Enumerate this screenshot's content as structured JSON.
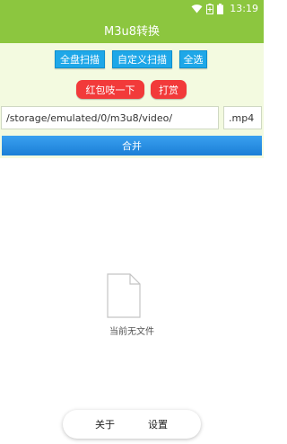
{
  "status_bar": {
    "time": "13:19"
  },
  "app_bar": {
    "title": "M3u8转换"
  },
  "toolbar": {
    "scan_all_label": "全盘扫描",
    "custom_scan_label": "自定义扫描",
    "select_all_label": "全选",
    "red_packet_label": "红包吱一下",
    "reward_label": "打赏"
  },
  "path_field": {
    "value": "/storage/emulated/0/m3u8/video/"
  },
  "ext_field": {
    "value": ".mp4"
  },
  "merge_button": {
    "label": "合并"
  },
  "empty_state": {
    "message": "当前无文件"
  },
  "bottom_nav": {
    "about_label": "关于",
    "settings_label": "设置"
  },
  "colors": {
    "appbar": "#8cc63f",
    "panel": "#f3fae0",
    "button_blue": "#1ea7e8",
    "button_red": "#f23a3a"
  }
}
